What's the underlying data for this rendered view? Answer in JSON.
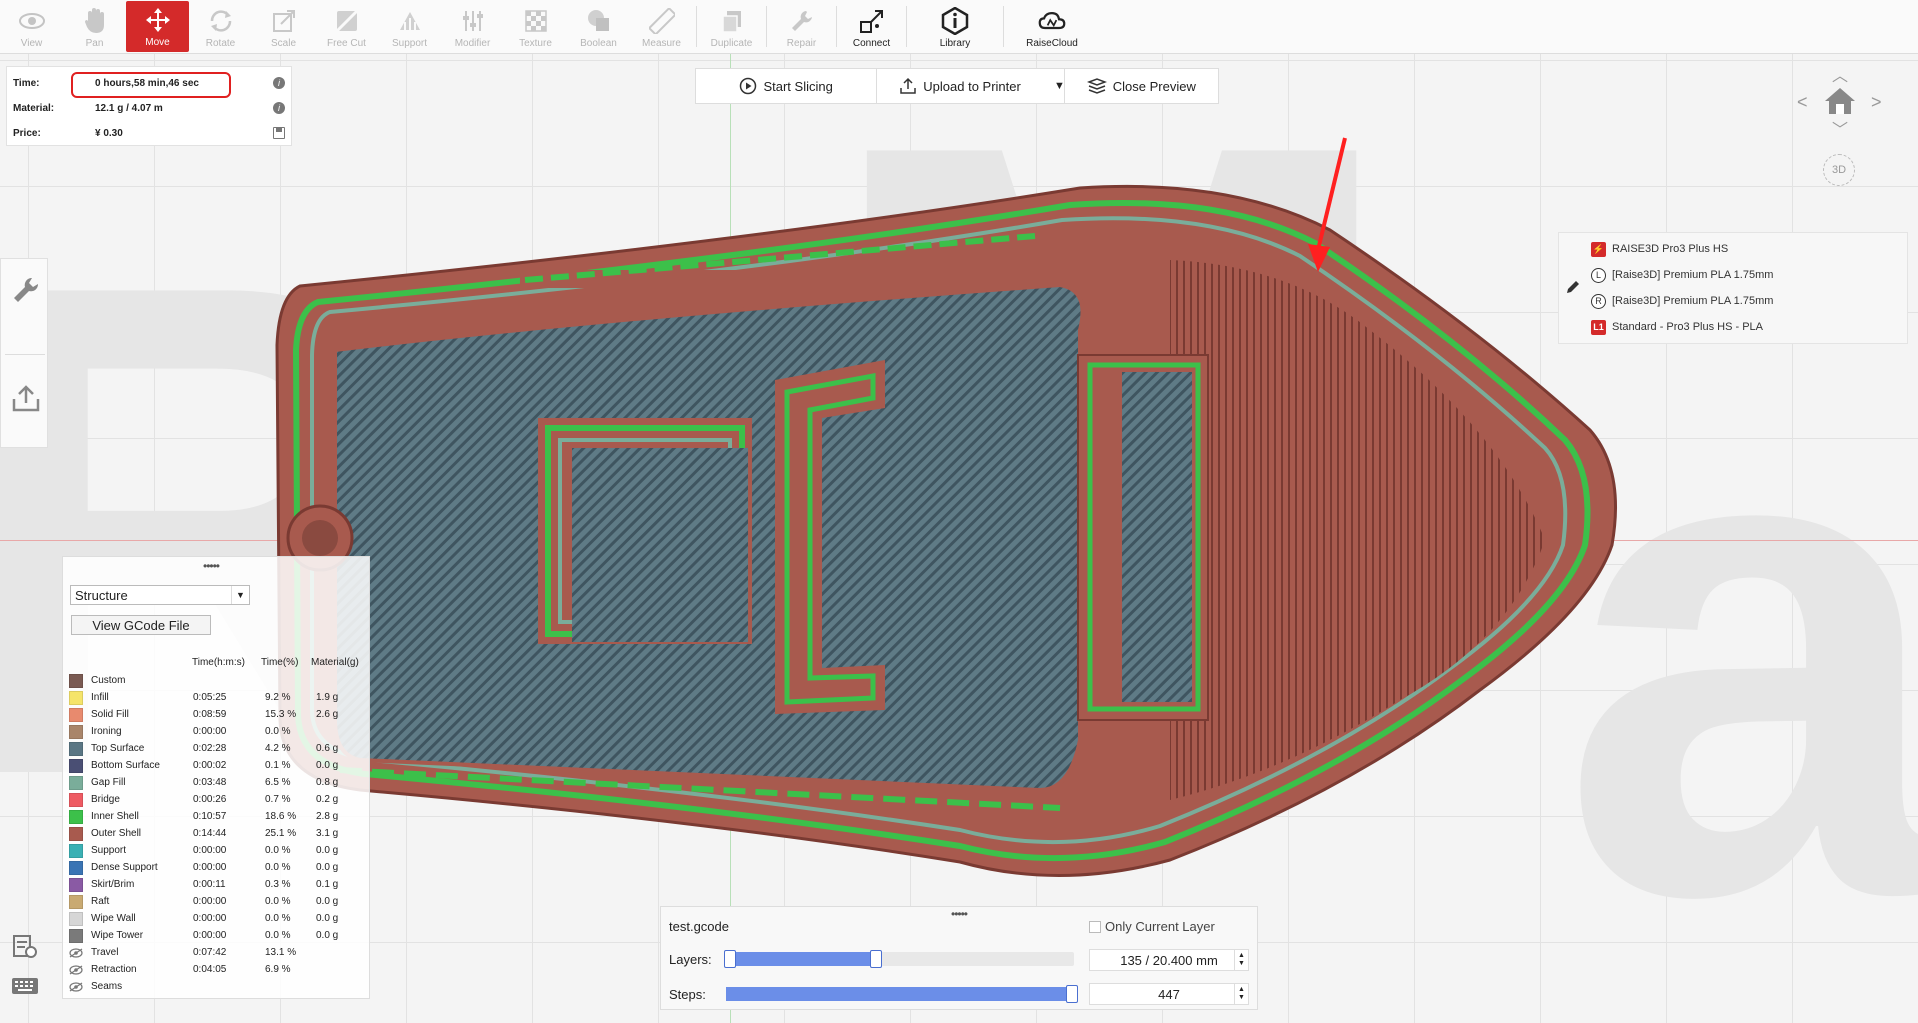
{
  "toolbar": {
    "items": [
      {
        "label": "View",
        "icon": "eye-icon",
        "state": "disabled"
      },
      {
        "label": "Pan",
        "icon": "hand-icon",
        "state": "disabled"
      },
      {
        "label": "Move",
        "icon": "move-icon",
        "state": "active"
      },
      {
        "label": "Rotate",
        "icon": "rotate-icon",
        "state": "disabled"
      },
      {
        "label": "Scale",
        "icon": "scale-icon",
        "state": "disabled"
      },
      {
        "label": "Free Cut",
        "icon": "cut-icon",
        "state": "disabled"
      },
      {
        "label": "Support",
        "icon": "support-icon",
        "state": "disabled"
      },
      {
        "label": "Modifier",
        "icon": "modifier-icon",
        "state": "disabled"
      },
      {
        "label": "Texture",
        "icon": "texture-icon",
        "state": "disabled"
      },
      {
        "label": "Boolean",
        "icon": "boolean-icon",
        "state": "disabled"
      },
      {
        "label": "Measure",
        "icon": "ruler-icon",
        "state": "disabled"
      },
      {
        "label": "Duplicate",
        "icon": "duplicate-icon",
        "state": "disabled"
      },
      {
        "label": "Repair",
        "icon": "wrench-icon",
        "state": "disabled"
      },
      {
        "label": "Connect",
        "icon": "connect-icon",
        "state": "enabled"
      },
      {
        "label": "Library",
        "icon": "library-icon",
        "state": "enabled"
      },
      {
        "label": "RaiseCloud",
        "icon": "cloud-icon",
        "state": "enabled"
      }
    ]
  },
  "info": {
    "time_label": "Time:",
    "time_value": "0 hours,58 min,46 sec",
    "material_label": "Material:",
    "material_value": "12.1 g / 4.07 m",
    "price_label": "Price:",
    "price_value": "¥ 0.30"
  },
  "actions": {
    "start_slicing": "Start Slicing",
    "upload": "Upload to Printer",
    "close_preview": "Close Preview"
  },
  "printer": {
    "model": "RAISE3D Pro3 Plus HS",
    "filament_left": "[Raise3D] Premium PLA 1.75mm",
    "filament_right": "[Raise3D] Premium PLA 1.75mm",
    "profile": "Standard - Pro3 Plus HS - PLA",
    "profile_badge": "L1"
  },
  "legend": {
    "mode": "Structure",
    "view_gcode": "View GCode File",
    "col_time": "Time(h:m:s)",
    "col_pct": "Time(%)",
    "col_mat": "Material(g)",
    "rows": [
      {
        "name": "Custom",
        "color": "#7a5a52",
        "time": "",
        "pct": "",
        "mat": ""
      },
      {
        "name": "Infill",
        "color": "#f5e46a",
        "time": "0:05:25",
        "pct": "9.2 %",
        "mat": "1.9 g"
      },
      {
        "name": "Solid Fill",
        "color": "#e88a6e",
        "time": "0:08:59",
        "pct": "15.3 %",
        "mat": "2.6 g"
      },
      {
        "name": "Ironing",
        "color": "#a9856a",
        "time": "0:00:00",
        "pct": "0.0 %",
        "mat": ""
      },
      {
        "name": "Top Surface",
        "color": "#5a7684",
        "time": "0:02:28",
        "pct": "4.2 %",
        "mat": "0.6 g"
      },
      {
        "name": "Bottom Surface",
        "color": "#4a4f74",
        "time": "0:00:02",
        "pct": "0.1 %",
        "mat": "0.0 g"
      },
      {
        "name": "Gap Fill",
        "color": "#7aad9a",
        "time": "0:03:48",
        "pct": "6.5 %",
        "mat": "0.8 g"
      },
      {
        "name": "Bridge",
        "color": "#ee5a62",
        "time": "0:00:26",
        "pct": "0.7 %",
        "mat": "0.2 g"
      },
      {
        "name": "Inner Shell",
        "color": "#3cc04a",
        "time": "0:10:57",
        "pct": "18.6 %",
        "mat": "2.8 g"
      },
      {
        "name": "Outer Shell",
        "color": "#a85a4e",
        "time": "0:14:44",
        "pct": "25.1 %",
        "mat": "3.1 g"
      },
      {
        "name": "Support",
        "color": "#3ab0b4",
        "time": "0:00:00",
        "pct": "0.0 %",
        "mat": "0.0 g"
      },
      {
        "name": "Dense Support",
        "color": "#3a74b4",
        "time": "0:00:00",
        "pct": "0.0 %",
        "mat": "0.0 g"
      },
      {
        "name": "Skirt/Brim",
        "color": "#8a5aa4",
        "time": "0:00:11",
        "pct": "0.3 %",
        "mat": "0.1 g"
      },
      {
        "name": "Raft",
        "color": "#c9aa72",
        "time": "0:00:00",
        "pct": "0.0 %",
        "mat": "0.0 g"
      },
      {
        "name": "Wipe Wall",
        "color": "#d6d6d6",
        "time": "0:00:00",
        "pct": "0.0 %",
        "mat": "0.0 g"
      },
      {
        "name": "Wipe Tower",
        "color": "#7a7a7a",
        "time": "0:00:00",
        "pct": "0.0 %",
        "mat": "0.0 g"
      },
      {
        "name": "Travel",
        "color": "eye",
        "time": "0:07:42",
        "pct": "13.1 %",
        "mat": ""
      },
      {
        "name": "Retraction",
        "color": "eye",
        "time": "0:04:05",
        "pct": "6.9 %",
        "mat": ""
      },
      {
        "name": "Seams",
        "color": "eye",
        "time": "",
        "pct": "",
        "mat": ""
      }
    ]
  },
  "layers": {
    "filename": "test.gcode",
    "only_current_layer": "Only Current Layer",
    "layers_label": "Layers:",
    "layers_value": "135 / 20.400 mm",
    "layers_fraction": 0.43,
    "steps_label": "Steps:",
    "steps_value": "447",
    "steps_fraction": 1.0
  },
  "colors": {
    "accent": "#d42a2a",
    "outer_shell": "#a85a4e",
    "inner_shell": "#3cc04a",
    "top_surface": "#5a7684",
    "gap_fill": "#7aad9a"
  }
}
